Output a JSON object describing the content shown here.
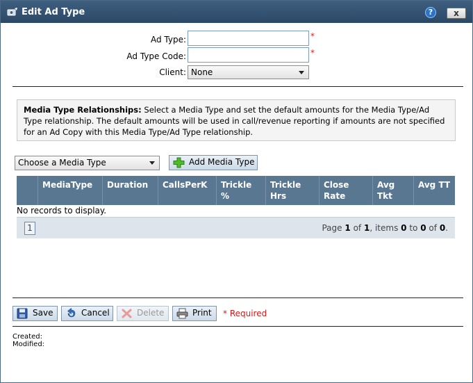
{
  "window": {
    "title": "Edit Ad Type",
    "help_label": "?",
    "close_label": "x"
  },
  "form": {
    "ad_type_label": "Ad Type:",
    "ad_type_value": "",
    "ad_type_code_label": "Ad Type Code:",
    "ad_type_code_value": "",
    "client_label": "Client:",
    "client_value": "None",
    "required_star": "*"
  },
  "info": {
    "heading": "Media Type Relationships:",
    "text": " Select a Media Type and set the default amounts for the Media Type/Ad Type relationship. The default amounts will be used in call/revenue reporting if amounts are not specified for an Ad Copy with this Media Type/Ad Type relationship."
  },
  "media": {
    "choose_value": "Choose a Media Type",
    "add_label": "Add Media Type"
  },
  "grid": {
    "columns": [
      "",
      "MediaType",
      "Duration",
      "CallsPerK",
      "Trickle %",
      "Trickle Hrs",
      "Close Rate",
      "Avg Tkt",
      "Avg TT"
    ],
    "empty_text": "No records to display.",
    "pager": {
      "current_page": "1",
      "page_label": "Page",
      "page_current": "1",
      "of_label": "of",
      "page_total": "1",
      "items_label": ", items",
      "items_from": "0",
      "to_label": "to",
      "items_to": "0",
      "of2_label": "of",
      "items_total": "0",
      "end": "."
    }
  },
  "footer": {
    "save_label": "Save",
    "cancel_label": "Cancel",
    "delete_label": "Delete",
    "print_label": "Print",
    "required_note": "* Required",
    "created_label": "Created:",
    "modified_label": "Modified:"
  },
  "colors": {
    "titlebar": "#2f4f70",
    "grid_header": "#5a7792",
    "required": "#d01a1a",
    "pager_bg": "#dde4ec"
  }
}
